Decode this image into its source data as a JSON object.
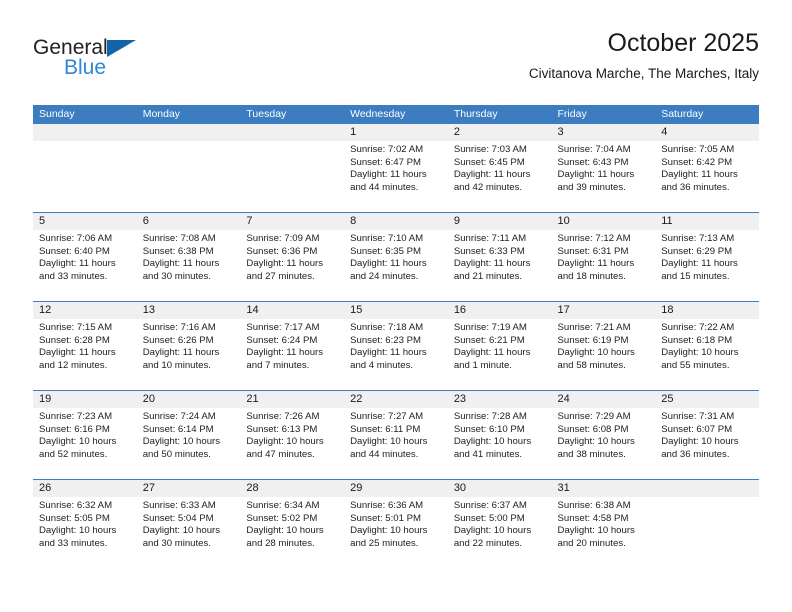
{
  "brand": {
    "name_top": "General",
    "name_bottom": "Blue",
    "accent_color": "#2e87d8",
    "triangle_color": "#1264a9"
  },
  "header": {
    "title": "October 2025",
    "subtitle": "Civitanova Marche, The Marches, Italy"
  },
  "theme": {
    "header_bar_color": "#3b7dc0",
    "day_band_color": "#f0f0f0",
    "row_rule_color": "#3b7dc0",
    "text_color": "#222222"
  },
  "weekdays": [
    "Sunday",
    "Monday",
    "Tuesday",
    "Wednesday",
    "Thursday",
    "Friday",
    "Saturday"
  ],
  "weeks": [
    [
      {
        "day": "",
        "sunrise": "",
        "sunset": "",
        "daylight1": "",
        "daylight2": ""
      },
      {
        "day": "",
        "sunrise": "",
        "sunset": "",
        "daylight1": "",
        "daylight2": ""
      },
      {
        "day": "",
        "sunrise": "",
        "sunset": "",
        "daylight1": "",
        "daylight2": ""
      },
      {
        "day": "1",
        "sunrise": "Sunrise: 7:02 AM",
        "sunset": "Sunset: 6:47 PM",
        "daylight1": "Daylight: 11 hours",
        "daylight2": "and 44 minutes."
      },
      {
        "day": "2",
        "sunrise": "Sunrise: 7:03 AM",
        "sunset": "Sunset: 6:45 PM",
        "daylight1": "Daylight: 11 hours",
        "daylight2": "and 42 minutes."
      },
      {
        "day": "3",
        "sunrise": "Sunrise: 7:04 AM",
        "sunset": "Sunset: 6:43 PM",
        "daylight1": "Daylight: 11 hours",
        "daylight2": "and 39 minutes."
      },
      {
        "day": "4",
        "sunrise": "Sunrise: 7:05 AM",
        "sunset": "Sunset: 6:42 PM",
        "daylight1": "Daylight: 11 hours",
        "daylight2": "and 36 minutes."
      }
    ],
    [
      {
        "day": "5",
        "sunrise": "Sunrise: 7:06 AM",
        "sunset": "Sunset: 6:40 PM",
        "daylight1": "Daylight: 11 hours",
        "daylight2": "and 33 minutes."
      },
      {
        "day": "6",
        "sunrise": "Sunrise: 7:08 AM",
        "sunset": "Sunset: 6:38 PM",
        "daylight1": "Daylight: 11 hours",
        "daylight2": "and 30 minutes."
      },
      {
        "day": "7",
        "sunrise": "Sunrise: 7:09 AM",
        "sunset": "Sunset: 6:36 PM",
        "daylight1": "Daylight: 11 hours",
        "daylight2": "and 27 minutes."
      },
      {
        "day": "8",
        "sunrise": "Sunrise: 7:10 AM",
        "sunset": "Sunset: 6:35 PM",
        "daylight1": "Daylight: 11 hours",
        "daylight2": "and 24 minutes."
      },
      {
        "day": "9",
        "sunrise": "Sunrise: 7:11 AM",
        "sunset": "Sunset: 6:33 PM",
        "daylight1": "Daylight: 11 hours",
        "daylight2": "and 21 minutes."
      },
      {
        "day": "10",
        "sunrise": "Sunrise: 7:12 AM",
        "sunset": "Sunset: 6:31 PM",
        "daylight1": "Daylight: 11 hours",
        "daylight2": "and 18 minutes."
      },
      {
        "day": "11",
        "sunrise": "Sunrise: 7:13 AM",
        "sunset": "Sunset: 6:29 PM",
        "daylight1": "Daylight: 11 hours",
        "daylight2": "and 15 minutes."
      }
    ],
    [
      {
        "day": "12",
        "sunrise": "Sunrise: 7:15 AM",
        "sunset": "Sunset: 6:28 PM",
        "daylight1": "Daylight: 11 hours",
        "daylight2": "and 12 minutes."
      },
      {
        "day": "13",
        "sunrise": "Sunrise: 7:16 AM",
        "sunset": "Sunset: 6:26 PM",
        "daylight1": "Daylight: 11 hours",
        "daylight2": "and 10 minutes."
      },
      {
        "day": "14",
        "sunrise": "Sunrise: 7:17 AM",
        "sunset": "Sunset: 6:24 PM",
        "daylight1": "Daylight: 11 hours",
        "daylight2": "and 7 minutes."
      },
      {
        "day": "15",
        "sunrise": "Sunrise: 7:18 AM",
        "sunset": "Sunset: 6:23 PM",
        "daylight1": "Daylight: 11 hours",
        "daylight2": "and 4 minutes."
      },
      {
        "day": "16",
        "sunrise": "Sunrise: 7:19 AM",
        "sunset": "Sunset: 6:21 PM",
        "daylight1": "Daylight: 11 hours",
        "daylight2": "and 1 minute."
      },
      {
        "day": "17",
        "sunrise": "Sunrise: 7:21 AM",
        "sunset": "Sunset: 6:19 PM",
        "daylight1": "Daylight: 10 hours",
        "daylight2": "and 58 minutes."
      },
      {
        "day": "18",
        "sunrise": "Sunrise: 7:22 AM",
        "sunset": "Sunset: 6:18 PM",
        "daylight1": "Daylight: 10 hours",
        "daylight2": "and 55 minutes."
      }
    ],
    [
      {
        "day": "19",
        "sunrise": "Sunrise: 7:23 AM",
        "sunset": "Sunset: 6:16 PM",
        "daylight1": "Daylight: 10 hours",
        "daylight2": "and 52 minutes."
      },
      {
        "day": "20",
        "sunrise": "Sunrise: 7:24 AM",
        "sunset": "Sunset: 6:14 PM",
        "daylight1": "Daylight: 10 hours",
        "daylight2": "and 50 minutes."
      },
      {
        "day": "21",
        "sunrise": "Sunrise: 7:26 AM",
        "sunset": "Sunset: 6:13 PM",
        "daylight1": "Daylight: 10 hours",
        "daylight2": "and 47 minutes."
      },
      {
        "day": "22",
        "sunrise": "Sunrise: 7:27 AM",
        "sunset": "Sunset: 6:11 PM",
        "daylight1": "Daylight: 10 hours",
        "daylight2": "and 44 minutes."
      },
      {
        "day": "23",
        "sunrise": "Sunrise: 7:28 AM",
        "sunset": "Sunset: 6:10 PM",
        "daylight1": "Daylight: 10 hours",
        "daylight2": "and 41 minutes."
      },
      {
        "day": "24",
        "sunrise": "Sunrise: 7:29 AM",
        "sunset": "Sunset: 6:08 PM",
        "daylight1": "Daylight: 10 hours",
        "daylight2": "and 38 minutes."
      },
      {
        "day": "25",
        "sunrise": "Sunrise: 7:31 AM",
        "sunset": "Sunset: 6:07 PM",
        "daylight1": "Daylight: 10 hours",
        "daylight2": "and 36 minutes."
      }
    ],
    [
      {
        "day": "26",
        "sunrise": "Sunrise: 6:32 AM",
        "sunset": "Sunset: 5:05 PM",
        "daylight1": "Daylight: 10 hours",
        "daylight2": "and 33 minutes."
      },
      {
        "day": "27",
        "sunrise": "Sunrise: 6:33 AM",
        "sunset": "Sunset: 5:04 PM",
        "daylight1": "Daylight: 10 hours",
        "daylight2": "and 30 minutes."
      },
      {
        "day": "28",
        "sunrise": "Sunrise: 6:34 AM",
        "sunset": "Sunset: 5:02 PM",
        "daylight1": "Daylight: 10 hours",
        "daylight2": "and 28 minutes."
      },
      {
        "day": "29",
        "sunrise": "Sunrise: 6:36 AM",
        "sunset": "Sunset: 5:01 PM",
        "daylight1": "Daylight: 10 hours",
        "daylight2": "and 25 minutes."
      },
      {
        "day": "30",
        "sunrise": "Sunrise: 6:37 AM",
        "sunset": "Sunset: 5:00 PM",
        "daylight1": "Daylight: 10 hours",
        "daylight2": "and 22 minutes."
      },
      {
        "day": "31",
        "sunrise": "Sunrise: 6:38 AM",
        "sunset": "Sunset: 4:58 PM",
        "daylight1": "Daylight: 10 hours",
        "daylight2": "and 20 minutes."
      },
      {
        "day": "",
        "sunrise": "",
        "sunset": "",
        "daylight1": "",
        "daylight2": ""
      }
    ]
  ]
}
